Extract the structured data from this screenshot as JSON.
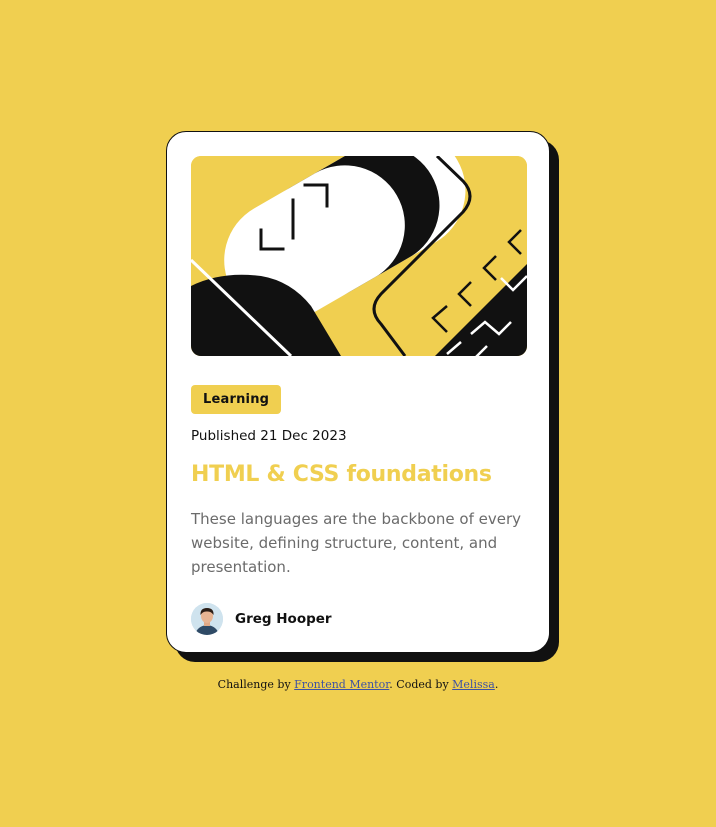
{
  "card": {
    "hero_image_name": "abstract-geometric-illustration",
    "tag": "Learning",
    "published": "Published 21 Dec 2023",
    "title": "HTML & CSS foundations",
    "description": "These languages are the backbone of every website, defining structure, content, and presentation.",
    "author": {
      "name": "Greg Hooper",
      "avatar_icon": "avatar-image"
    }
  },
  "attribution": {
    "prefix": "Challenge by ",
    "link1": "Frontend Mentor",
    "middle": ". Coded by ",
    "link2": "Melissa",
    "suffix": "."
  },
  "colors": {
    "background": "#f0cf50",
    "card": "#ffffff",
    "text": "#111111",
    "muted": "#6b6b6b"
  }
}
